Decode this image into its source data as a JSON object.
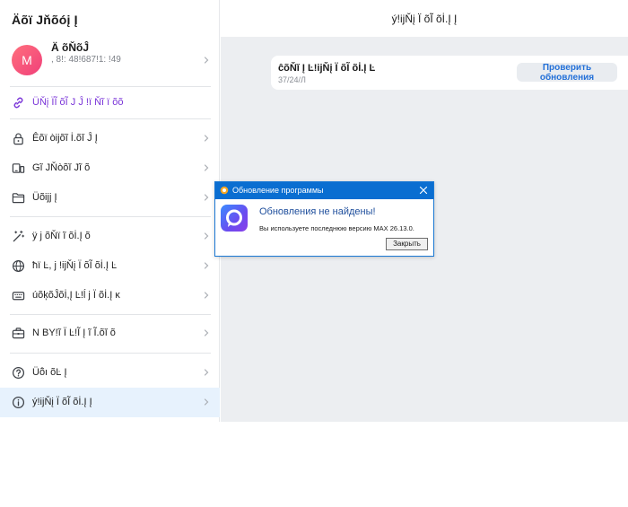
{
  "sidebar": {
    "title": "Äõï Jňõóį Į",
    "profile": {
      "avatar_letter": "M",
      "name": "Ä õŇõĴ",
      "phone": ", 8!: 48!687!1: !49"
    },
    "link_item": {
      "label": "ÜŇį ÏĨ õĨ J Ĵ !ï Ňĩ ï õõ",
      "icon": "link-icon"
    },
    "group1": [
      {
        "label": "Êõï òijõĩ İ.õĭ Ĵ Į",
        "icon": "lock-icon"
      },
      {
        "label": "Gĩ JŇòõĭ Jĩ õ",
        "icon": "devices-icon"
      },
      {
        "label": "Üõijj Į",
        "icon": "folder-icon"
      }
    ],
    "group2": [
      {
        "label": "ÿ j õŇï ĩ õİ.Į õ",
        "icon": "magic-wand-icon"
      },
      {
        "label": "ħï Ŀ, j !ijŇį Ï õĨ õİ.Į Ŀ",
        "icon": "globe-icon"
      },
      {
        "label": "úõķõĴõİ,Į Ŀ!ĺ j Ï õİ.Į ĸ",
        "icon": "keyboard-icon"
      }
    ],
    "group3": [
      {
        "label": "N BY!ĩ Ï Ŀ!Ĩ Į ĩ Ĩ.õĭ õ",
        "icon": "briefcase-icon"
      }
    ],
    "group4": [
      {
        "label": "Üõ̇ı õĿ Į",
        "icon": "help-icon"
      },
      {
        "label": "ý!ijŇį Ï õĨ õİ.Į Į",
        "icon": "info-icon"
      }
    ]
  },
  "main": {
    "title": "ý!ijŇį Ï õĨ õİ.Į Į",
    "version_card": {
      "title": "ĉõŇĭ Į Ŀ!ijŇį Ï õĨ õİ.Į Ŀ",
      "version": "37/24/Л",
      "check_button": "Проверить обновления"
    }
  },
  "dialog": {
    "title": "Обновление программы",
    "heading": "Обновления не найдены!",
    "message": "Вы используете последнюю версию MAX 26.13.0.",
    "ok_button": "Закрыть"
  },
  "colors": {
    "accent": "#2370d8",
    "link": "#7a35d8",
    "active_item": "#e7f2fd",
    "dialog_titlebar": "#0a6ed1",
    "avatar": "#f0407a"
  }
}
